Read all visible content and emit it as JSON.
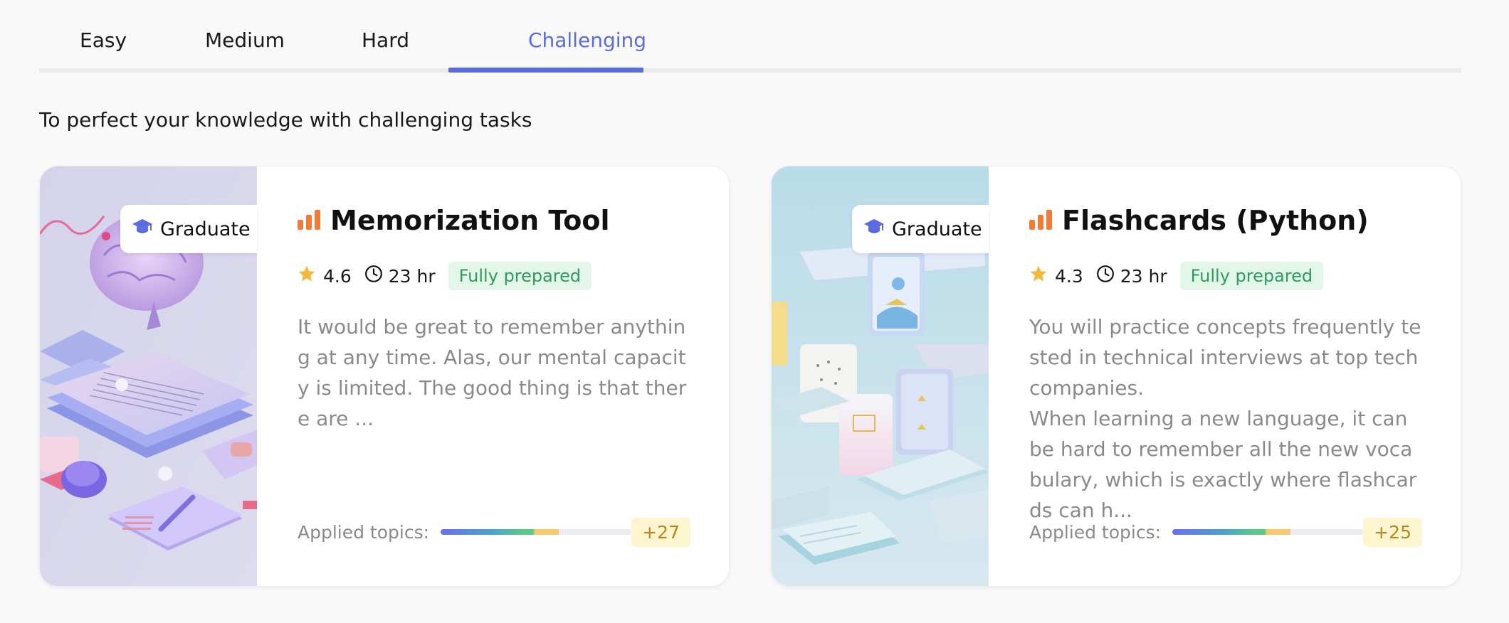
{
  "tabs": [
    {
      "label": "Easy",
      "active": false
    },
    {
      "label": "Medium",
      "active": false
    },
    {
      "label": "Hard",
      "active": false
    },
    {
      "label": "Challenging",
      "active": true
    }
  ],
  "accent_color": "#5b6be0",
  "subtitle": "To perfect your knowledge with challenging tasks",
  "cards": [
    {
      "badge": {
        "icon": "graduation-cap-icon",
        "label": "Graduate"
      },
      "difficulty_icon": "signal-bars-icon",
      "title": "Memorization Tool",
      "rating": "4.6",
      "duration": "23 hr",
      "status": "Fully prepared",
      "description": "It would be great to remember anything at any time. Alas, our mental capacity is limited. The good thing is that there are ...",
      "topics_label": "Applied topics:",
      "topics_progress": 0.62,
      "topics_count": "+27",
      "image_icon": "brain-illustration"
    },
    {
      "badge": {
        "icon": "graduation-cap-icon",
        "label": "Graduate"
      },
      "difficulty_icon": "signal-bars-icon",
      "title": "Flashcards (Python)",
      "rating": "4.3",
      "duration": "23 hr",
      "status": "Fully prepared",
      "description": "You will practice concepts frequently tested in technical interviews at top tech companies.\nWhen learning a new language, it can be hard to remember all the new vocabulary, which is exactly where flashcards can h...",
      "topics_label": "Applied topics:",
      "topics_progress": 0.62,
      "topics_count": "+25",
      "image_icon": "flashcards-illustration"
    }
  ]
}
